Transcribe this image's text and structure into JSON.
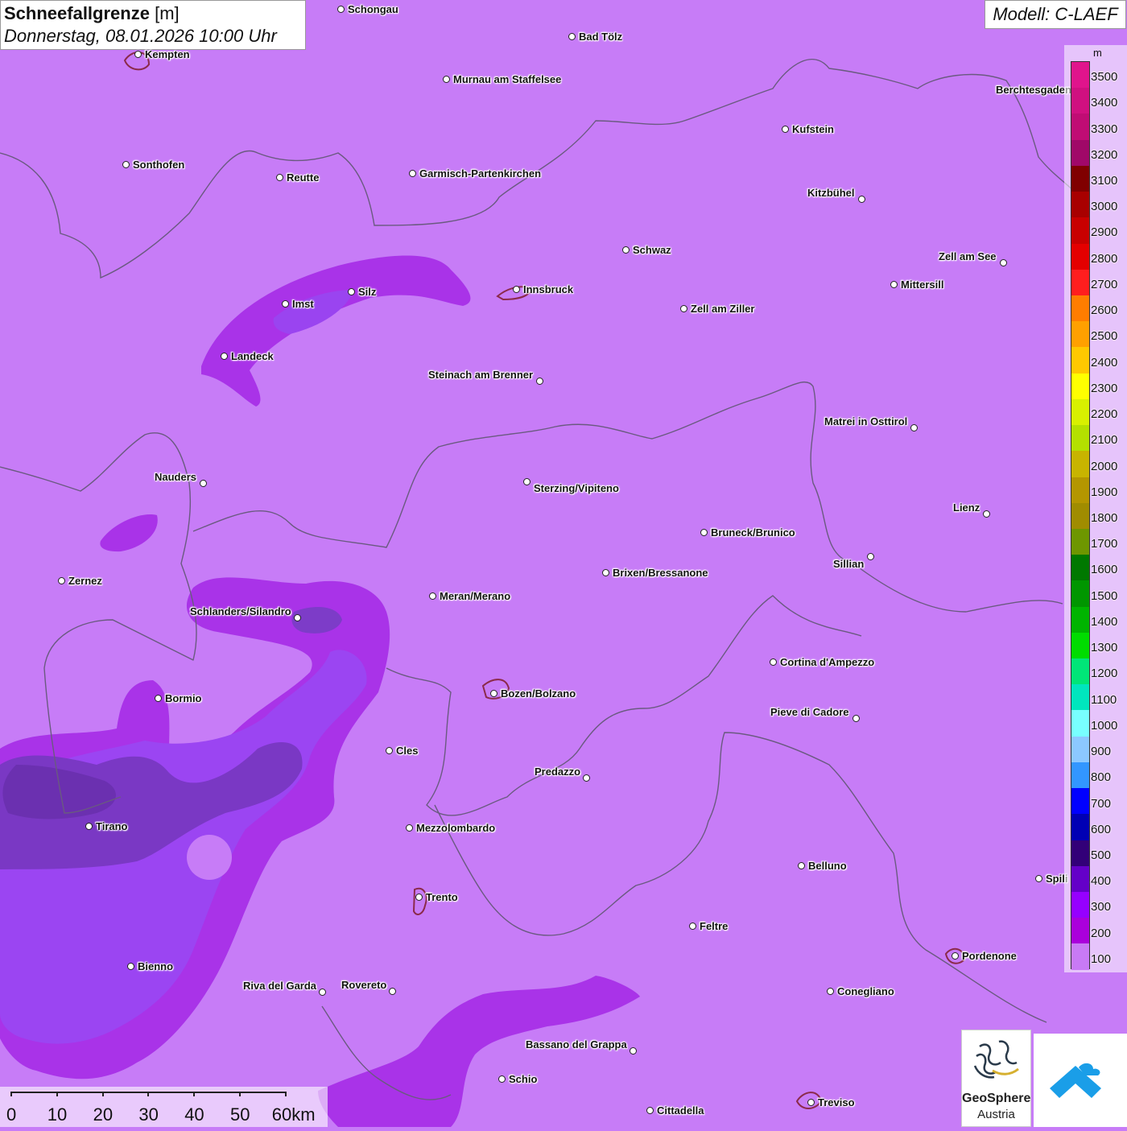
{
  "header": {
    "title": "Schneefallgrenze",
    "unit": "[m]",
    "datetime": "Donnerstag, 08.01.2026 10:00 Uhr",
    "model": "Modell: C-LAEF"
  },
  "legend": {
    "unit": "m",
    "entries": [
      {
        "label": "3500",
        "color": "#e0148c"
      },
      {
        "label": "3400",
        "color": "#d01080"
      },
      {
        "label": "3300",
        "color": "#c00c74"
      },
      {
        "label": "3200",
        "color": "#a00868"
      },
      {
        "label": "3100",
        "color": "#800000"
      },
      {
        "label": "3000",
        "color": "#a80000"
      },
      {
        "label": "2900",
        "color": "#c80000"
      },
      {
        "label": "2800",
        "color": "#e40000"
      },
      {
        "label": "2700",
        "color": "#ff1e1e"
      },
      {
        "label": "2600",
        "color": "#ff7d00"
      },
      {
        "label": "2500",
        "color": "#ffa000"
      },
      {
        "label": "2400",
        "color": "#ffc800"
      },
      {
        "label": "2300",
        "color": "#ffff00"
      },
      {
        "label": "2200",
        "color": "#d8f000"
      },
      {
        "label": "2100",
        "color": "#b4e000"
      },
      {
        "label": "2000",
        "color": "#c8b400"
      },
      {
        "label": "1900",
        "color": "#b49600"
      },
      {
        "label": "1800",
        "color": "#a08c00"
      },
      {
        "label": "1700",
        "color": "#6e9600"
      },
      {
        "label": "1600",
        "color": "#007800"
      },
      {
        "label": "1500",
        "color": "#009600"
      },
      {
        "label": "1400",
        "color": "#00b400"
      },
      {
        "label": "1300",
        "color": "#00dc00"
      },
      {
        "label": "1200",
        "color": "#00e678"
      },
      {
        "label": "1100",
        "color": "#00e6be"
      },
      {
        "label": "1000",
        "color": "#78ffff"
      },
      {
        "label": "900",
        "color": "#8cc8ff"
      },
      {
        "label": "800",
        "color": "#3296ff"
      },
      {
        "label": "700",
        "color": "#0000ff"
      },
      {
        "label": "600",
        "color": "#0000b4"
      },
      {
        "label": "500",
        "color": "#320078"
      },
      {
        "label": "400",
        "color": "#6400c8"
      },
      {
        "label": "300",
        "color": "#9600ff"
      },
      {
        "label": "200",
        "color": "#aa00dc"
      },
      {
        "label": "100",
        "color": "#c87af5"
      }
    ]
  },
  "cities": [
    {
      "name": "Schongau"
    },
    {
      "name": "Kempten"
    },
    {
      "name": "Bad Tölz"
    },
    {
      "name": "Murnau am Staffelsee"
    },
    {
      "name": "Berchtesgaden"
    },
    {
      "name": "Kufstein"
    },
    {
      "name": "Sonthofen"
    },
    {
      "name": "Reutte"
    },
    {
      "name": "Garmisch-Partenkirchen"
    },
    {
      "name": "Kitzbühel"
    },
    {
      "name": "Schwaz"
    },
    {
      "name": "Zell am See"
    },
    {
      "name": "Mittersill"
    },
    {
      "name": "Innsbruck"
    },
    {
      "name": "Silz"
    },
    {
      "name": "Imst"
    },
    {
      "name": "Zell am Ziller"
    },
    {
      "name": "Landeck"
    },
    {
      "name": "Steinach am Brenner"
    },
    {
      "name": "Matrei in Osttirol"
    },
    {
      "name": "Nauders"
    },
    {
      "name": "Sterzing/Vipiteno"
    },
    {
      "name": "Lienz"
    },
    {
      "name": "Bruneck/Brunico"
    },
    {
      "name": "Sillian"
    },
    {
      "name": "Zernez"
    },
    {
      "name": "Brixen/Bressanone"
    },
    {
      "name": "Meran/Merano"
    },
    {
      "name": "Schlanders/Silandro"
    },
    {
      "name": "Cortina d'Ampezzo"
    },
    {
      "name": "Bormio"
    },
    {
      "name": "Bozen/Bolzano"
    },
    {
      "name": "Pieve di Cadore"
    },
    {
      "name": "Cles"
    },
    {
      "name": "Predazzo"
    },
    {
      "name": "Tirano"
    },
    {
      "name": "Mezzolombardo"
    },
    {
      "name": "Belluno"
    },
    {
      "name": "Spili"
    },
    {
      "name": "Trento"
    },
    {
      "name": "Feltre"
    },
    {
      "name": "Pordenone"
    },
    {
      "name": "Bienno"
    },
    {
      "name": "Riva del Garda"
    },
    {
      "name": "Rovereto"
    },
    {
      "name": "Conegliano"
    },
    {
      "name": "Bassano del Grappa"
    },
    {
      "name": "Schio"
    },
    {
      "name": "Treviso"
    },
    {
      "name": "Cittadella"
    }
  ],
  "scale": {
    "labels": [
      "0",
      "10",
      "20",
      "30",
      "40",
      "50",
      "60km"
    ]
  },
  "logos": {
    "geosphere_name": "GeoSphere",
    "geosphere_country": "Austria"
  }
}
